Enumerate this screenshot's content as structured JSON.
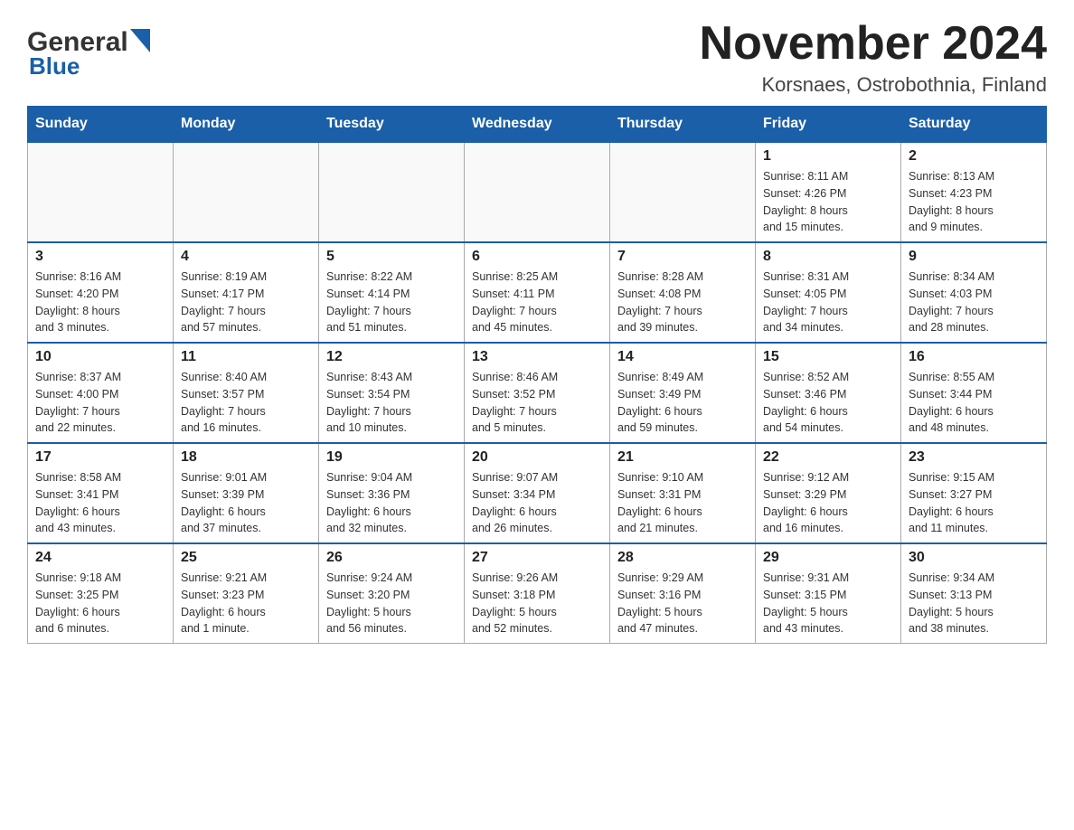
{
  "header": {
    "logo_text1": "General",
    "logo_text2": "Blue",
    "month_title": "November 2024",
    "location": "Korsnaes, Ostrobothnia, Finland"
  },
  "weekdays": [
    "Sunday",
    "Monday",
    "Tuesday",
    "Wednesday",
    "Thursday",
    "Friday",
    "Saturday"
  ],
  "weeks": [
    [
      {
        "day": "",
        "info": ""
      },
      {
        "day": "",
        "info": ""
      },
      {
        "day": "",
        "info": ""
      },
      {
        "day": "",
        "info": ""
      },
      {
        "day": "",
        "info": ""
      },
      {
        "day": "1",
        "info": "Sunrise: 8:11 AM\nSunset: 4:26 PM\nDaylight: 8 hours\nand 15 minutes."
      },
      {
        "day": "2",
        "info": "Sunrise: 8:13 AM\nSunset: 4:23 PM\nDaylight: 8 hours\nand 9 minutes."
      }
    ],
    [
      {
        "day": "3",
        "info": "Sunrise: 8:16 AM\nSunset: 4:20 PM\nDaylight: 8 hours\nand 3 minutes."
      },
      {
        "day": "4",
        "info": "Sunrise: 8:19 AM\nSunset: 4:17 PM\nDaylight: 7 hours\nand 57 minutes."
      },
      {
        "day": "5",
        "info": "Sunrise: 8:22 AM\nSunset: 4:14 PM\nDaylight: 7 hours\nand 51 minutes."
      },
      {
        "day": "6",
        "info": "Sunrise: 8:25 AM\nSunset: 4:11 PM\nDaylight: 7 hours\nand 45 minutes."
      },
      {
        "day": "7",
        "info": "Sunrise: 8:28 AM\nSunset: 4:08 PM\nDaylight: 7 hours\nand 39 minutes."
      },
      {
        "day": "8",
        "info": "Sunrise: 8:31 AM\nSunset: 4:05 PM\nDaylight: 7 hours\nand 34 minutes."
      },
      {
        "day": "9",
        "info": "Sunrise: 8:34 AM\nSunset: 4:03 PM\nDaylight: 7 hours\nand 28 minutes."
      }
    ],
    [
      {
        "day": "10",
        "info": "Sunrise: 8:37 AM\nSunset: 4:00 PM\nDaylight: 7 hours\nand 22 minutes."
      },
      {
        "day": "11",
        "info": "Sunrise: 8:40 AM\nSunset: 3:57 PM\nDaylight: 7 hours\nand 16 minutes."
      },
      {
        "day": "12",
        "info": "Sunrise: 8:43 AM\nSunset: 3:54 PM\nDaylight: 7 hours\nand 10 minutes."
      },
      {
        "day": "13",
        "info": "Sunrise: 8:46 AM\nSunset: 3:52 PM\nDaylight: 7 hours\nand 5 minutes."
      },
      {
        "day": "14",
        "info": "Sunrise: 8:49 AM\nSunset: 3:49 PM\nDaylight: 6 hours\nand 59 minutes."
      },
      {
        "day": "15",
        "info": "Sunrise: 8:52 AM\nSunset: 3:46 PM\nDaylight: 6 hours\nand 54 minutes."
      },
      {
        "day": "16",
        "info": "Sunrise: 8:55 AM\nSunset: 3:44 PM\nDaylight: 6 hours\nand 48 minutes."
      }
    ],
    [
      {
        "day": "17",
        "info": "Sunrise: 8:58 AM\nSunset: 3:41 PM\nDaylight: 6 hours\nand 43 minutes."
      },
      {
        "day": "18",
        "info": "Sunrise: 9:01 AM\nSunset: 3:39 PM\nDaylight: 6 hours\nand 37 minutes."
      },
      {
        "day": "19",
        "info": "Sunrise: 9:04 AM\nSunset: 3:36 PM\nDaylight: 6 hours\nand 32 minutes."
      },
      {
        "day": "20",
        "info": "Sunrise: 9:07 AM\nSunset: 3:34 PM\nDaylight: 6 hours\nand 26 minutes."
      },
      {
        "day": "21",
        "info": "Sunrise: 9:10 AM\nSunset: 3:31 PM\nDaylight: 6 hours\nand 21 minutes."
      },
      {
        "day": "22",
        "info": "Sunrise: 9:12 AM\nSunset: 3:29 PM\nDaylight: 6 hours\nand 16 minutes."
      },
      {
        "day": "23",
        "info": "Sunrise: 9:15 AM\nSunset: 3:27 PM\nDaylight: 6 hours\nand 11 minutes."
      }
    ],
    [
      {
        "day": "24",
        "info": "Sunrise: 9:18 AM\nSunset: 3:25 PM\nDaylight: 6 hours\nand 6 minutes."
      },
      {
        "day": "25",
        "info": "Sunrise: 9:21 AM\nSunset: 3:23 PM\nDaylight: 6 hours\nand 1 minute."
      },
      {
        "day": "26",
        "info": "Sunrise: 9:24 AM\nSunset: 3:20 PM\nDaylight: 5 hours\nand 56 minutes."
      },
      {
        "day": "27",
        "info": "Sunrise: 9:26 AM\nSunset: 3:18 PM\nDaylight: 5 hours\nand 52 minutes."
      },
      {
        "day": "28",
        "info": "Sunrise: 9:29 AM\nSunset: 3:16 PM\nDaylight: 5 hours\nand 47 minutes."
      },
      {
        "day": "29",
        "info": "Sunrise: 9:31 AM\nSunset: 3:15 PM\nDaylight: 5 hours\nand 43 minutes."
      },
      {
        "day": "30",
        "info": "Sunrise: 9:34 AM\nSunset: 3:13 PM\nDaylight: 5 hours\nand 38 minutes."
      }
    ]
  ]
}
